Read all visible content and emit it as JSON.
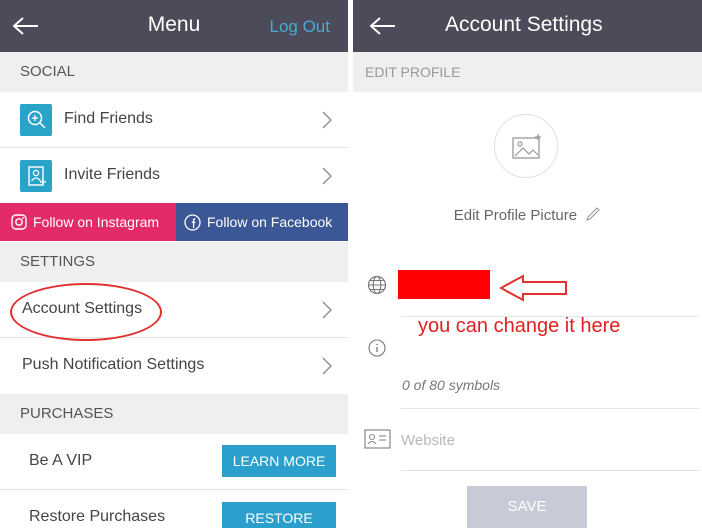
{
  "menu": {
    "title": "Menu",
    "logout_label": "Log Out",
    "sections": {
      "social": "SOCIAL",
      "settings": "SETTINGS",
      "purchases": "PURCHASES"
    },
    "social_items": [
      {
        "label": "Find Friends",
        "icon": "find-friends-icon"
      },
      {
        "label": "Invite Friends",
        "icon": "invite-friends-icon"
      }
    ],
    "follow": {
      "instagram": "Follow on Instagram",
      "facebook": "Follow on Facebook"
    },
    "settings_items": [
      {
        "label": "Account Settings"
      },
      {
        "label": "Push Notification Settings"
      }
    ],
    "purchases_items": [
      {
        "label": "Be A VIP",
        "button": "LEARN MORE"
      },
      {
        "label": "Restore Purchases",
        "button": "RESTORE"
      }
    ]
  },
  "account": {
    "title": "Account Settings",
    "section": "EDIT PROFILE",
    "edit_picture_label": "Edit Profile Picture",
    "bio_counter": "0 of 80 symbols",
    "website_placeholder": "Website",
    "save_label": "SAVE"
  },
  "annotation": {
    "text": "you can change it here"
  },
  "colors": {
    "header": "#4b4b59",
    "accent_blue": "#2ba0cc",
    "instagram": "#e32b6a",
    "facebook": "#3b5795",
    "annotation_red": "#e02020"
  }
}
